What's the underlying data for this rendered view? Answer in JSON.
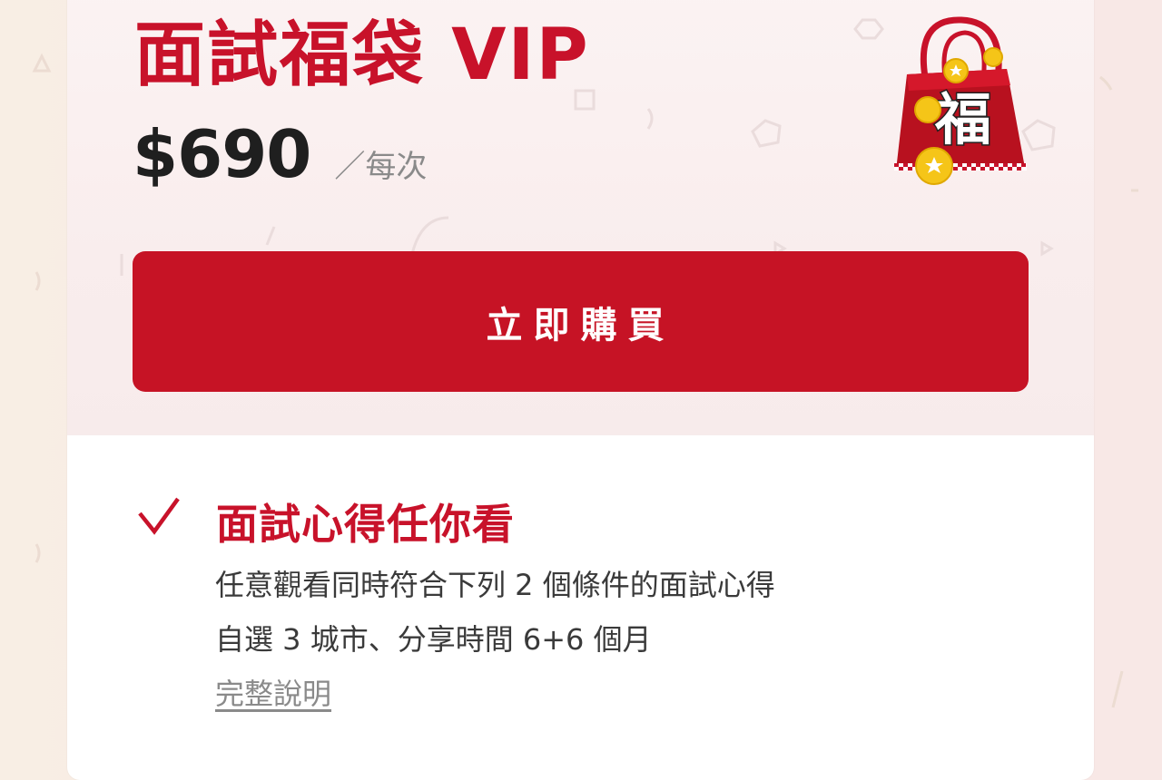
{
  "plan": {
    "title": "面試福袋 VIP",
    "price": "$690",
    "unit": "／每次",
    "badge_char": "福"
  },
  "actions": {
    "buy_label": "立即購買"
  },
  "feature": {
    "title": "面試心得任你看",
    "lines": [
      "任意觀看同時符合下列 2 個條件的面試心得",
      "自選 3 城市、分享時間 6+6 個月"
    ],
    "more_link": "完整說明"
  },
  "colors": {
    "brand": "#c8122a",
    "button": "#c61325",
    "text": "#1f1f1f",
    "muted": "#8a8a8a"
  }
}
